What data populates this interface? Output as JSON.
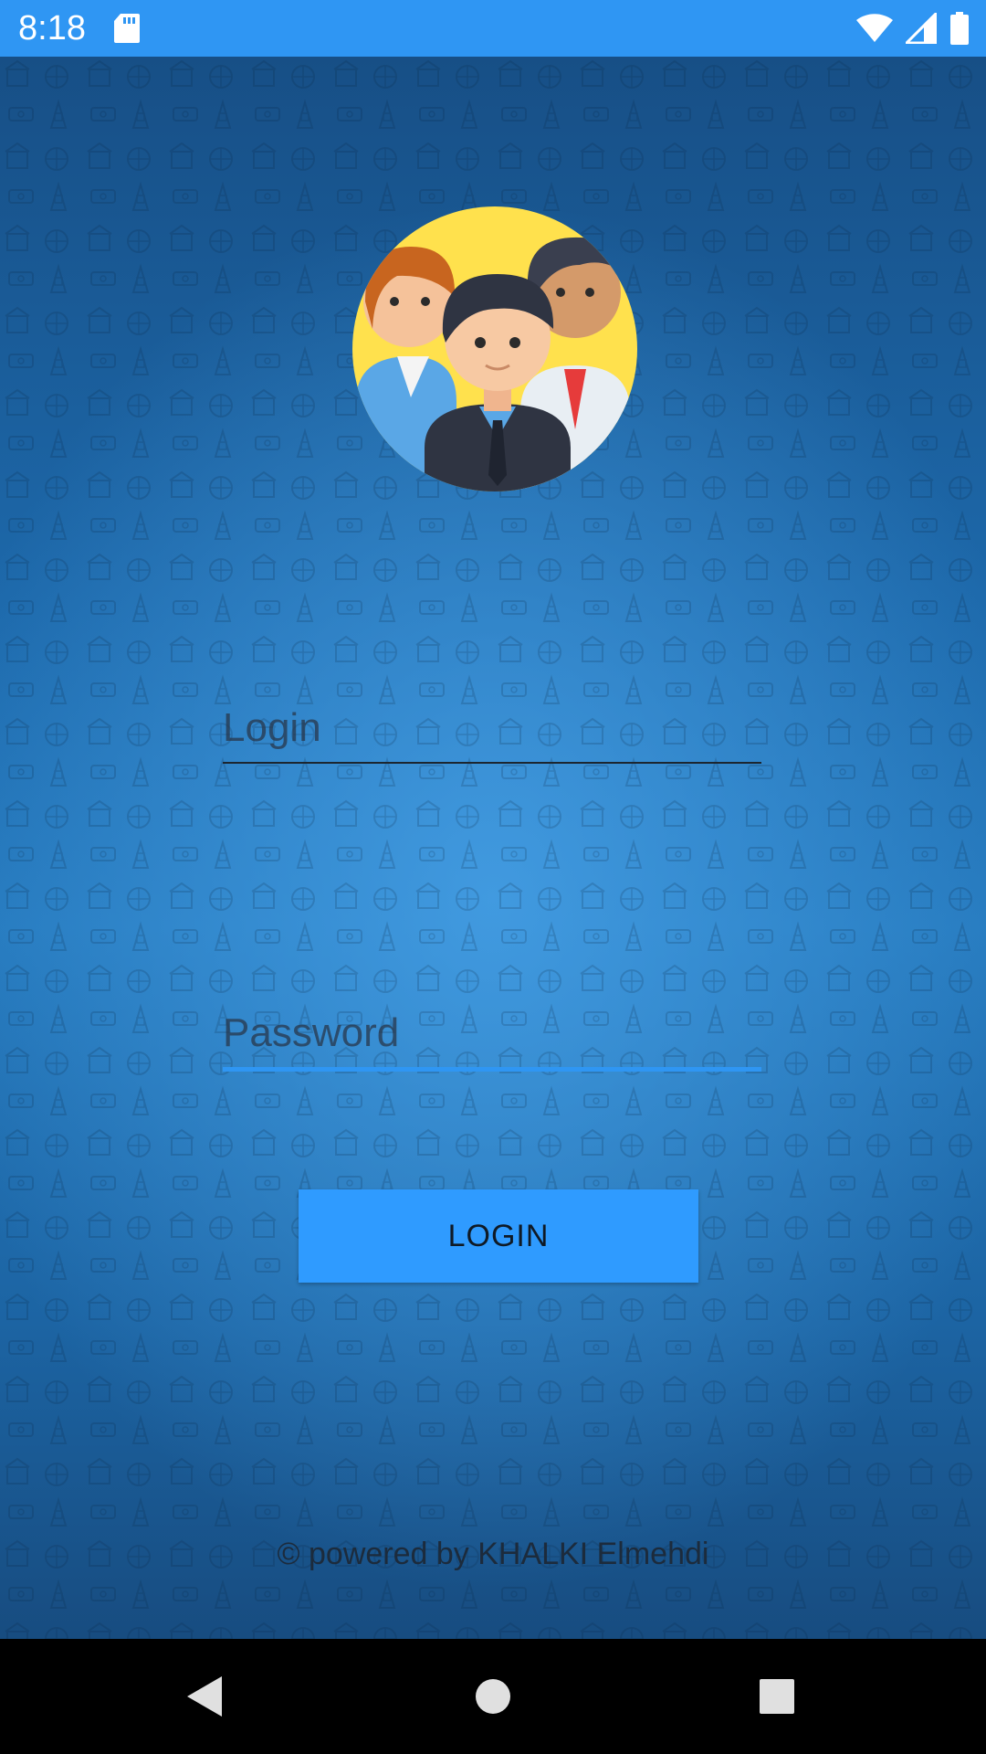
{
  "status_bar": {
    "time": "8:18",
    "icons": [
      "sd-card-icon",
      "wifi-icon",
      "signal-icon",
      "battery-icon"
    ]
  },
  "avatar": {
    "icon": "team-avatar-icon"
  },
  "login_field": {
    "placeholder": "Login",
    "value": ""
  },
  "password_field": {
    "placeholder": "Password",
    "value": ""
  },
  "login_button": {
    "label": "LOGIN"
  },
  "footer": {
    "text": "© powered by KHALKI Elmehdi"
  },
  "nav_bar": {
    "icons": [
      "back-icon",
      "home-icon",
      "recents-icon"
    ]
  },
  "colors": {
    "status_bar": "#2f96f3",
    "button": "#2f9bff",
    "focused_underline": "#2f96f3",
    "background_dark": "#174f86",
    "background_light": "#3ea0e6"
  }
}
